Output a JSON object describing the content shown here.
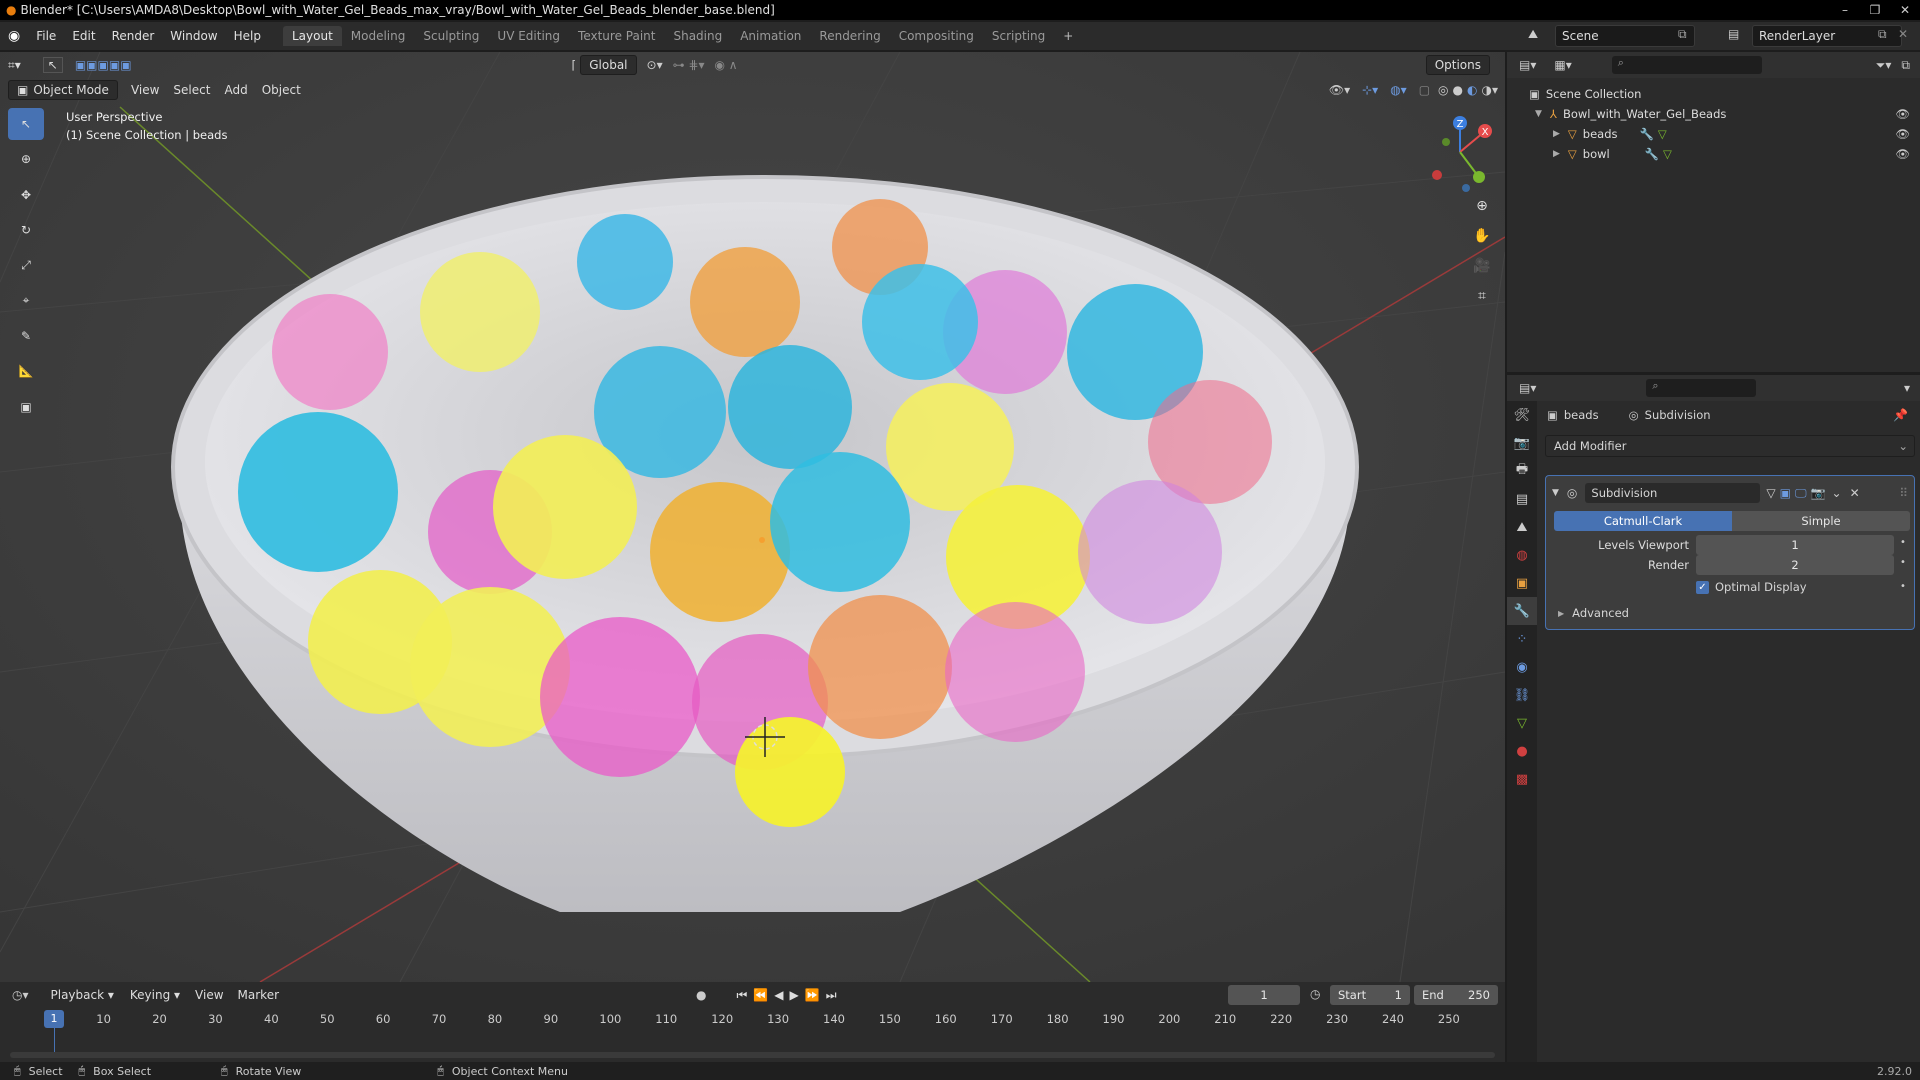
{
  "window": {
    "title": "Blender* [C:\\Users\\AMDA8\\Desktop\\Bowl_with_Water_Gel_Beads_max_vray/Bowl_with_Water_Gel_Beads_blender_base.blend]",
    "controls": [
      "–",
      "❐",
      "✕"
    ]
  },
  "menu": [
    "File",
    "Edit",
    "Render",
    "Window",
    "Help"
  ],
  "workspaces": [
    {
      "label": "Layout",
      "active": true
    },
    {
      "label": "Modeling"
    },
    {
      "label": "Sculpting"
    },
    {
      "label": "UV Editing"
    },
    {
      "label": "Texture Paint"
    },
    {
      "label": "Shading"
    },
    {
      "label": "Animation"
    },
    {
      "label": "Rendering"
    },
    {
      "label": "Compositing"
    },
    {
      "label": "Scripting"
    }
  ],
  "add_workspace": "+",
  "scene": {
    "name": "Scene",
    "view_layer": "RenderLayer"
  },
  "viewport": {
    "mode": "Object Mode",
    "menus": [
      "View",
      "Select",
      "Add",
      "Object"
    ],
    "transform_orientation": "Global",
    "options_label": "Options",
    "info_line1": "User Perspective",
    "info_line2": "(1) Scene Collection | beads",
    "gizmo_axes": {
      "x": "X",
      "y": "Y",
      "z": "Z"
    }
  },
  "tools": [
    "select-box",
    "cursor",
    "move",
    "rotate",
    "scale",
    "transform",
    "annotate",
    "measure",
    "add-cube"
  ],
  "outliner": {
    "root": "Scene Collection",
    "items": [
      {
        "label": "Bowl_with_Water_Gel_Beads",
        "depth": 1
      },
      {
        "label": "beads",
        "depth": 2
      },
      {
        "label": "bowl",
        "depth": 2
      }
    ]
  },
  "properties": {
    "breadcrumb_object": "beads",
    "breadcrumb_modifier": "Subdivision",
    "add_modifier": "Add Modifier",
    "modifier": {
      "name": "Subdivision",
      "type_options": [
        "Catmull-Clark",
        "Simple"
      ],
      "active_type": "Catmull-Clark",
      "levels_viewport_label": "Levels Viewport",
      "levels_viewport": "1",
      "render_label": "Render",
      "render": "2",
      "optimal_display_label": "Optimal Display",
      "optimal_display": true,
      "advanced_label": "Advanced"
    }
  },
  "timeline": {
    "menus": [
      "Playback",
      "Keying",
      "View",
      "Marker"
    ],
    "current_frame": "1",
    "start_label": "Start",
    "start": "1",
    "end_label": "End",
    "end": "250",
    "ruler": [
      "10",
      "20",
      "30",
      "40",
      "50",
      "60",
      "70",
      "80",
      "90",
      "100",
      "110",
      "120",
      "130",
      "140",
      "150",
      "160",
      "170",
      "180",
      "190",
      "200",
      "210",
      "220",
      "230",
      "240",
      "250"
    ],
    "playhead": "1"
  },
  "status": {
    "select": "Select",
    "box_select": "Box Select",
    "rotate_view": "Rotate View",
    "context_menu": "Object Context Menu",
    "version": "2.92.0"
  },
  "colors": {
    "accent": "#4772b3",
    "x_axis": "#e64c4c",
    "y_axis": "#7ab82e",
    "z_axis": "#3c7fe0"
  }
}
